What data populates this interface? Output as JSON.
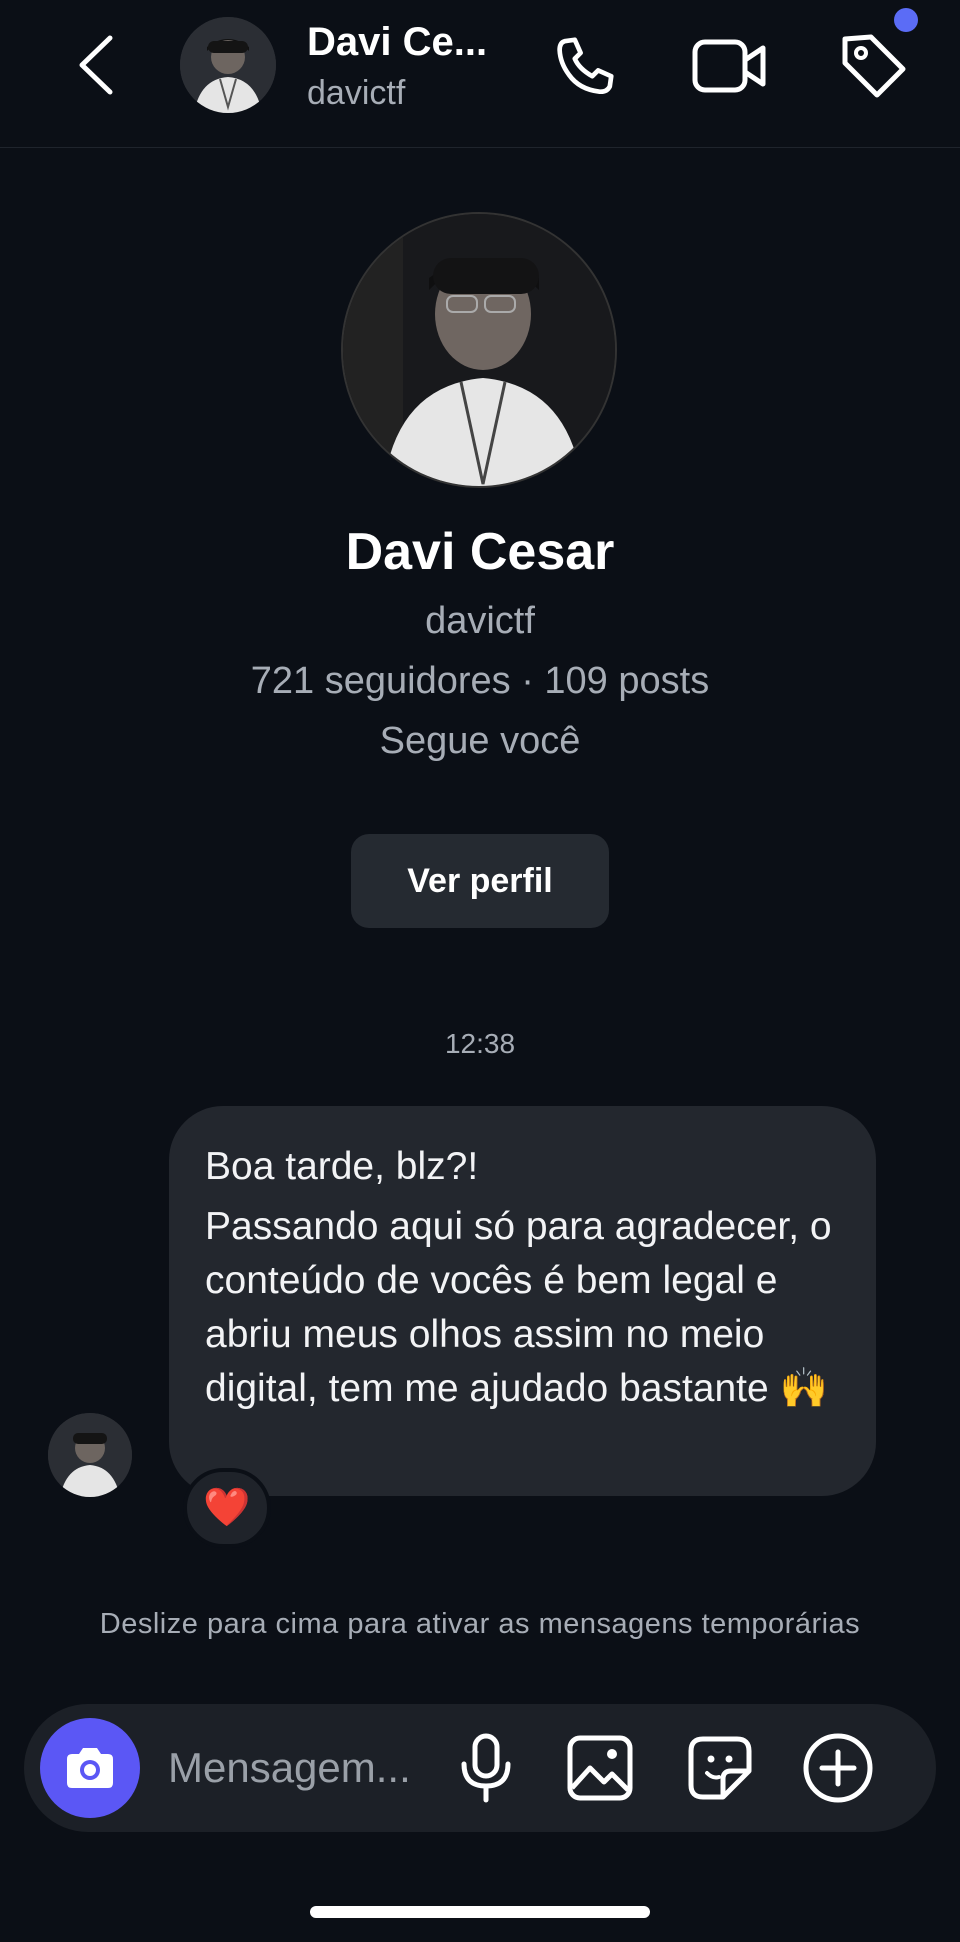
{
  "header": {
    "name": "Davi Ce...",
    "username": "davictf"
  },
  "profile": {
    "name": "Davi Cesar",
    "username": "davictf",
    "stats": "721 seguidores · 109 posts",
    "follows_you": "Segue você",
    "view_profile_label": "Ver perfil"
  },
  "chat": {
    "timestamp": "12:38",
    "message": {
      "line1": "Boa tarde, blz?!",
      "line2": "Passando aqui só para agradecer, o conteúdo de vocês é bem legal e abriu meus olhos assim no meio digital, tem me ajudado bastante 🙌"
    },
    "reaction": "❤️"
  },
  "hint": "Deslize para cima para ativar as mensagens temporárias",
  "composer": {
    "placeholder": "Mensagem..."
  },
  "icons": {
    "back": "chevron-left-icon",
    "call": "phone-icon",
    "video": "video-camera-icon",
    "tag": "tag-icon",
    "camera": "camera-icon",
    "mic": "microphone-icon",
    "gallery": "image-icon",
    "sticker": "sticker-icon",
    "more": "plus-circle-icon"
  },
  "colors": {
    "background": "#0b0f16",
    "bubble": "#23272e",
    "accent": "#5b57f5",
    "notification_dot": "#5b6cf6"
  }
}
